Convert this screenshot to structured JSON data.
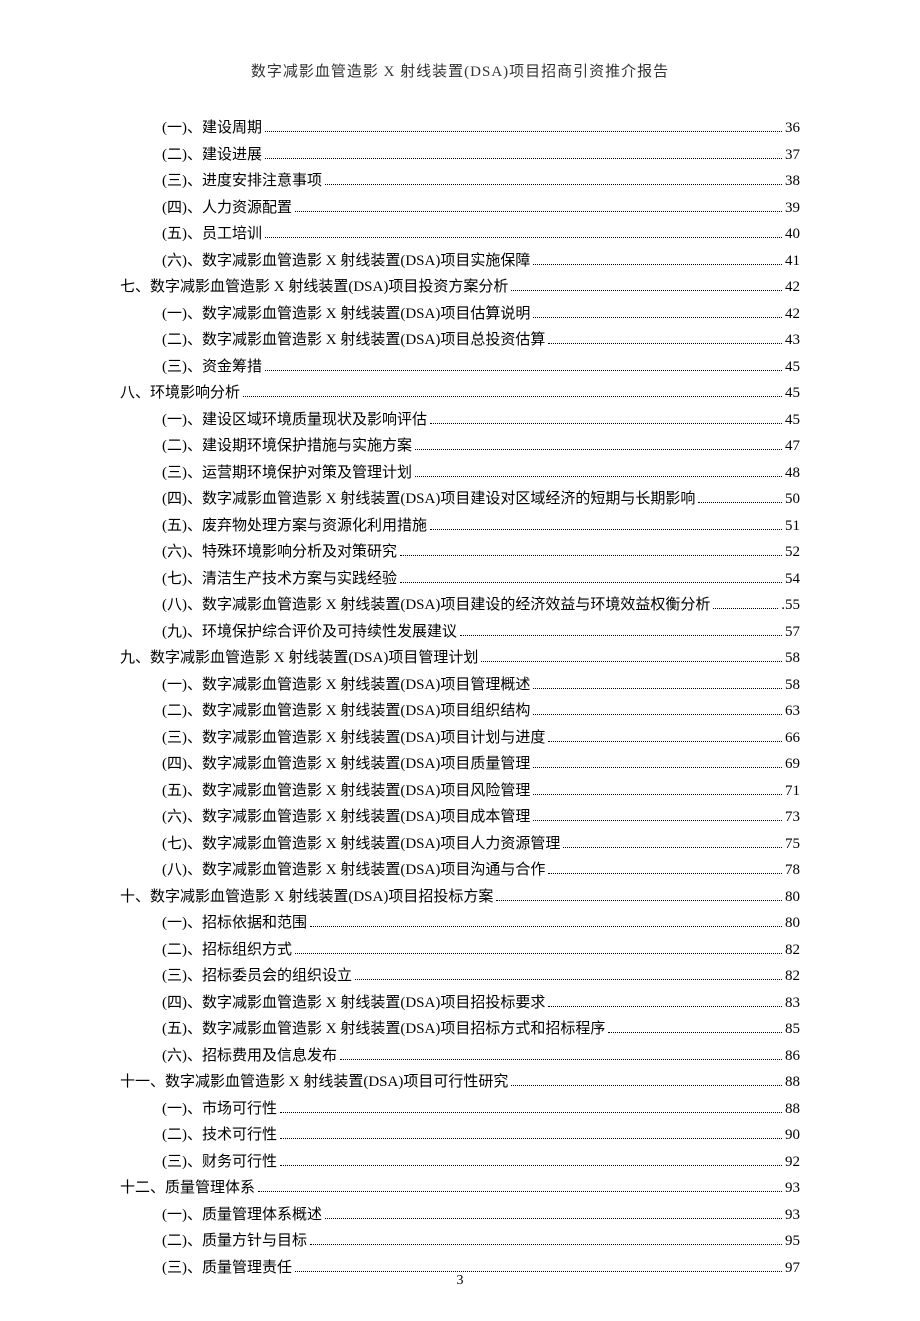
{
  "header": "数字减影血管造影 X 射线装置(DSA)项目招商引资推介报告",
  "page_number": "3",
  "toc": [
    {
      "level": 2,
      "label": "(一)、建设周期",
      "pg": "36"
    },
    {
      "level": 2,
      "label": "(二)、建设进展",
      "pg": "37"
    },
    {
      "level": 2,
      "label": "(三)、进度安排注意事项",
      "pg": "38"
    },
    {
      "level": 2,
      "label": "(四)、人力资源配置",
      "pg": "39"
    },
    {
      "level": 2,
      "label": "(五)、员工培训",
      "pg": "40"
    },
    {
      "level": 2,
      "label": "(六)、数字减影血管造影 X 射线装置(DSA)项目实施保障",
      "pg": "41"
    },
    {
      "level": 1,
      "label": "七、数字减影血管造影 X 射线装置(DSA)项目投资方案分析",
      "pg": "42"
    },
    {
      "level": 2,
      "label": "(一)、数字减影血管造影 X 射线装置(DSA)项目估算说明",
      "pg": "42"
    },
    {
      "level": 2,
      "label": "(二)、数字减影血管造影 X 射线装置(DSA)项目总投资估算",
      "pg": "43"
    },
    {
      "level": 2,
      "label": "(三)、资金筹措",
      "pg": "45"
    },
    {
      "level": 1,
      "label": "八、环境影响分析",
      "pg": "45"
    },
    {
      "level": 2,
      "label": "(一)、建设区域环境质量现状及影响评估",
      "pg": "45"
    },
    {
      "level": 2,
      "label": "(二)、建设期环境保护措施与实施方案",
      "pg": "47"
    },
    {
      "level": 2,
      "label": "(三)、运营期环境保护对策及管理计划",
      "pg": "48"
    },
    {
      "level": 2,
      "label": "(四)、数字减影血管造影 X 射线装置(DSA)项目建设对区域经济的短期与长期影响",
      "pg": "50"
    },
    {
      "level": 2,
      "label": "(五)、废弃物处理方案与资源化利用措施",
      "pg": "51"
    },
    {
      "level": 2,
      "label": "(六)、特殊环境影响分析及对策研究",
      "pg": "52"
    },
    {
      "level": 2,
      "label": "(七)、清洁生产技术方案与实践经验",
      "pg": "54"
    },
    {
      "level": 2,
      "label": "(八)、数字减影血管造影 X 射线装置(DSA)项目建设的经济效益与环境效益权衡分析",
      "pg": ".55"
    },
    {
      "level": 2,
      "label": "(九)、环境保护综合评价及可持续性发展建议",
      "pg": "57"
    },
    {
      "level": 1,
      "label": "九、数字减影血管造影 X 射线装置(DSA)项目管理计划",
      "pg": "58"
    },
    {
      "level": 2,
      "label": "(一)、数字减影血管造影 X 射线装置(DSA)项目管理概述",
      "pg": "58"
    },
    {
      "level": 2,
      "label": "(二)、数字减影血管造影 X 射线装置(DSA)项目组织结构",
      "pg": "63"
    },
    {
      "level": 2,
      "label": "(三)、数字减影血管造影 X 射线装置(DSA)项目计划与进度",
      "pg": "66"
    },
    {
      "level": 2,
      "label": "(四)、数字减影血管造影 X 射线装置(DSA)项目质量管理",
      "pg": "69"
    },
    {
      "level": 2,
      "label": "(五)、数字减影血管造影 X 射线装置(DSA)项目风险管理",
      "pg": "71"
    },
    {
      "level": 2,
      "label": "(六)、数字减影血管造影 X 射线装置(DSA)项目成本管理",
      "pg": "73"
    },
    {
      "level": 2,
      "label": "(七)、数字减影血管造影 X 射线装置(DSA)项目人力资源管理",
      "pg": "75"
    },
    {
      "level": 2,
      "label": "(八)、数字减影血管造影 X 射线装置(DSA)项目沟通与合作",
      "pg": "78"
    },
    {
      "level": 1,
      "label": "十、数字减影血管造影 X 射线装置(DSA)项目招投标方案",
      "pg": "80"
    },
    {
      "level": 2,
      "label": "(一)、招标依据和范围",
      "pg": "80"
    },
    {
      "level": 2,
      "label": "(二)、招标组织方式",
      "pg": "82"
    },
    {
      "level": 2,
      "label": "(三)、招标委员会的组织设立",
      "pg": "82"
    },
    {
      "level": 2,
      "label": "(四)、数字减影血管造影 X 射线装置(DSA)项目招投标要求",
      "pg": "83"
    },
    {
      "level": 2,
      "label": "(五)、数字减影血管造影 X 射线装置(DSA)项目招标方式和招标程序",
      "pg": "85"
    },
    {
      "level": 2,
      "label": "(六)、招标费用及信息发布",
      "pg": "86"
    },
    {
      "level": 1,
      "label": "十一、数字减影血管造影 X 射线装置(DSA)项目可行性研究",
      "pg": "88"
    },
    {
      "level": 2,
      "label": "(一)、市场可行性",
      "pg": "88"
    },
    {
      "level": 2,
      "label": "(二)、技术可行性",
      "pg": "90"
    },
    {
      "level": 2,
      "label": "(三)、财务可行性",
      "pg": "92"
    },
    {
      "level": 1,
      "label": "十二、质量管理体系",
      "pg": "93"
    },
    {
      "level": 2,
      "label": "(一)、质量管理体系概述",
      "pg": "93"
    },
    {
      "level": 2,
      "label": "(二)、质量方针与目标",
      "pg": "95"
    },
    {
      "level": 2,
      "label": "(三)、质量管理责任",
      "pg": "97"
    }
  ]
}
